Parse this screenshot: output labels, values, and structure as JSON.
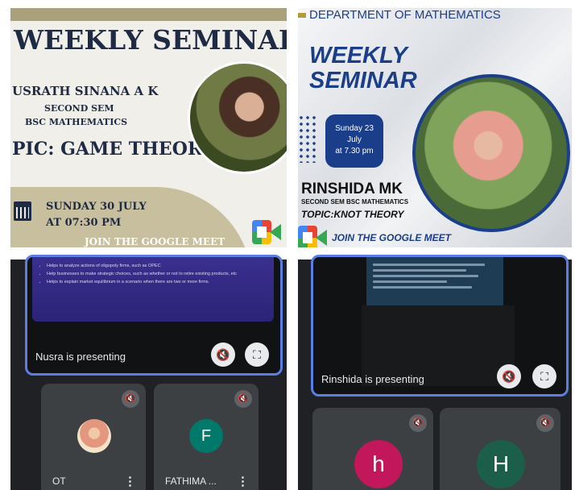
{
  "poster_left": {
    "title": "WEEKLY SEMINAR",
    "presenter": "USRATH SINANA A K",
    "semester": "SECOND SEM",
    "course": "BSC MATHEMATICS",
    "topic": "PIC: GAME THEORY",
    "date": "SUNDAY 30 JULY",
    "time": "AT 07:30 PM",
    "join": "JOIN THE GOOGLE MEET",
    "icons": [
      "calendar-icon",
      "google-meet-icon"
    ]
  },
  "poster_right": {
    "department": "DEPARTMENT OF MATHEMATICS",
    "title_line1": "WEEKLY",
    "title_line2": "SEMINAR",
    "date_day": "Sunday 23",
    "date_month": "July",
    "date_time": "at 7.30 pm",
    "presenter": "RINSHIDA MK",
    "semester": "SECOND SEM BSC MATHEMATICS",
    "topic": "TOPIC:KNOT THEORY",
    "join": "JOIN THE GOOGLE MEET",
    "icons": [
      "google-meet-icon"
    ]
  },
  "meet_left": {
    "slide_bullets": [
      "Helps to analyze actions of oligopoly firms, such as OPEC",
      "Help businesses to make strategic choices, such as whether or not to retire existing products, etc",
      "Helps to explain market equilibrium in a scenario when there are two or more firms."
    ],
    "presenting_label": "Nusra is presenting",
    "participants": [
      {
        "name": "OT",
        "initial": "",
        "mic": "mic-off-icon"
      },
      {
        "name": "FATHIMA ...",
        "initial": "F",
        "mic": "mic-off-icon"
      }
    ],
    "controls": {
      "mute_icon": "mic-off-icon",
      "fullscreen_icon": "fullscreen-icon",
      "more_icon": "more-vert-icon"
    },
    "accent_color": "#5b7ee5"
  },
  "meet_right": {
    "presenting_label": "Rinshida is presenting",
    "participants": [
      {
        "name": "",
        "initial": "h",
        "mic": "mic-off-icon"
      },
      {
        "name": "",
        "initial": "H",
        "mic": "mic-off-icon"
      }
    ],
    "controls": {
      "mute_icon": "mic-off-icon",
      "fullscreen_icon": "fullscreen-icon"
    },
    "accent_color": "#5b7ee5"
  }
}
